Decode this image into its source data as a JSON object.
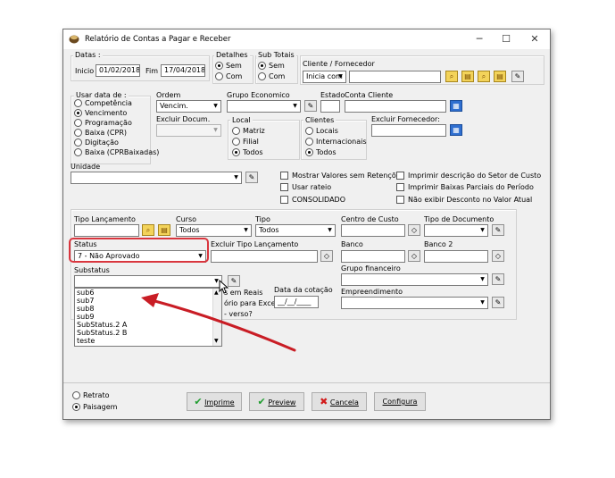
{
  "window": {
    "title": "Relatório de Contas a Pagar e Receber",
    "minimize": "─",
    "maximize": "☐",
    "close": "✕"
  },
  "datas": {
    "title": "Datas :",
    "inicio_label": "Inicio",
    "inicio_value": "01/02/2018",
    "fim_label": "Fim",
    "fim_value": "17/04/2018"
  },
  "detalhes": {
    "title": "Detalhes",
    "options": [
      "Sem",
      "Com"
    ],
    "selected": "Sem"
  },
  "subtotais": {
    "title": "Sub Totais",
    "options": [
      "Sem",
      "Com"
    ],
    "selected": "Sem"
  },
  "cliente": {
    "title": "Cliente / Fornecedor",
    "mode_value": "Inicia com",
    "value": ""
  },
  "usar_data": {
    "title": "Usar data de :",
    "options": [
      "Competência",
      "Vencimento",
      "Programação",
      "Baixa (CPR)",
      "Digitação",
      "Baixa (CPRBaixadas)"
    ],
    "selected": "Vencimento"
  },
  "ordem": {
    "label": "Ordem",
    "value": "Vencim."
  },
  "excluir_docum": {
    "label": "Excluir Docum.",
    "value": ""
  },
  "grupo_economico": {
    "label": "Grupo Economico",
    "value": ""
  },
  "local": {
    "title": "Local",
    "options": [
      "Matriz",
      "Filial",
      "Todos"
    ],
    "selected": "Todos"
  },
  "estado": {
    "label": "Estado",
    "value": ""
  },
  "conta_cliente": {
    "label": "Conta Cliente",
    "value": ""
  },
  "clientes": {
    "title": "Clientes",
    "options": [
      "Locais",
      "Internacionais",
      "Todos"
    ],
    "selected": "Todos"
  },
  "excluir_fornecedor": {
    "label": "Excluir Fornecedor:",
    "value": ""
  },
  "unidade": {
    "label": "Unidade",
    "value": ""
  },
  "checks_left": [
    {
      "label": "Mostrar Valores sem Retenções",
      "checked": false
    },
    {
      "label": "Usar rateio",
      "checked": false
    },
    {
      "label": "CONSOLIDADO",
      "checked": false
    }
  ],
  "checks_right": [
    {
      "label": "Imprimir descrição do Setor de Custo",
      "checked": false
    },
    {
      "label": "Imprimir Baixas Parciais do Período",
      "checked": false
    },
    {
      "label": "Não exibir Desconto no Valor Atual",
      "checked": false
    }
  ],
  "tipo_lancamento": {
    "label": "Tipo Lançamento",
    "value": ""
  },
  "curso": {
    "label": "Curso",
    "value": "Todos"
  },
  "tipo": {
    "label": "Tipo",
    "value": "Todos"
  },
  "centro_custo": {
    "label": "Centro de Custo",
    "value": ""
  },
  "tipo_documento": {
    "label": "Tipo de Documento",
    "value": ""
  },
  "status": {
    "label": "Status",
    "value": "7 - Não Aprovado"
  },
  "excluir_tipo_lancamento": {
    "label": "Excluir Tipo Lançamento",
    "value": ""
  },
  "banco": {
    "label": "Banco",
    "value": ""
  },
  "banco2": {
    "label": "Banco 2",
    "value": ""
  },
  "substatus": {
    "label": "Substatus",
    "value": "",
    "options": [
      "sub6",
      "sub7",
      "sub8",
      "sub9",
      "SubStatus.2 A",
      "SubStatus.2 B",
      "teste"
    ]
  },
  "grupo_financeiro": {
    "label": "Grupo financeiro",
    "value": ""
  },
  "partial_labels": {
    "em_reais": "s em Reais",
    "para_excel": "ório para Excel",
    "verso": "- verso?"
  },
  "data_cotacao": {
    "label": "Data da cotação",
    "value": "__/__/____"
  },
  "empreendimento": {
    "label": "Empreendimento",
    "value": ""
  },
  "layout_radio": {
    "options": [
      "Retrato",
      "Paisagem"
    ],
    "selected": "Paisagem"
  },
  "buttons": {
    "imprime": "Imprime",
    "preview": "Preview",
    "cancela": "Cancela",
    "configura": "Configura"
  },
  "colors": {
    "highlight": "#d9363e",
    "arrow": "#c91d25"
  }
}
